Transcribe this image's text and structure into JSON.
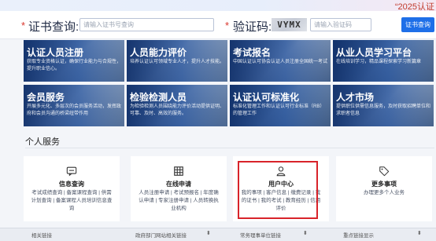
{
  "header": {
    "marquee": "“2025认证"
  },
  "search": {
    "cert_label": "证书查询:",
    "cert_placeholder": "请输入证书号查询",
    "captcha_label": "验证码:",
    "captcha_text": "VYMX",
    "captcha_placeholder": "请输入验证码",
    "button_label": "证书查询"
  },
  "tiles": [
    {
      "title": "认证人员注册",
      "desc": "获取专业资格认证，确保行业能力与合规性，提升职业信心。"
    },
    {
      "title": "人员能力评价",
      "desc": "培养认证认可领域专业人才，提升人才技能。"
    },
    {
      "title": "考试报名",
      "desc": "中国认证认可协会认证人员注册全国统一考试"
    },
    {
      "title": "从业人员学习平台",
      "desc": "在线培训学习，精品课程探索学习新篇章"
    },
    {
      "title": "会员服务",
      "desc": "开展多元化、多层次的会员服务活动，发挥政府和会员沟通的桥梁纽带作用"
    },
    {
      "title": "检验检测人员",
      "desc": "为检验检测人员围绕能力评价活动提供证明、可靠、及时、高效的服务。"
    },
    {
      "title": "认证认可标准化",
      "desc": "标准化管理工作和认证认可行业标准（RB）的管理工作"
    },
    {
      "title": "人才市场",
      "desc": "提供职位供需信息服务，及时获取招聘单位和求职者信息"
    }
  ],
  "personal": {
    "section_title": "个人服务",
    "cards": [
      {
        "title": "信息查询",
        "desc": "考试成绩查询 | 备案课程查询 | 供需计划查询 | 备案课程人员培训信息查询"
      },
      {
        "title": "在线申请",
        "desc": "人员注册申请 | 考试预报名 | 年度确认申请 | 专家注册申请 | 人员转换执业机构"
      },
      {
        "title": "用户中心",
        "desc": "我的事项 | 客户信息 | 缴费记录 | 我的证书 | 我的考试 | 教育经历 | 信用评价"
      },
      {
        "title": "更多事项",
        "desc": "办理更多个人业务"
      }
    ]
  },
  "footer": {
    "links": [
      "相关链接",
      "政府部门网站相关链接",
      "常务理事单位链接",
      "重点链接显示"
    ]
  }
}
